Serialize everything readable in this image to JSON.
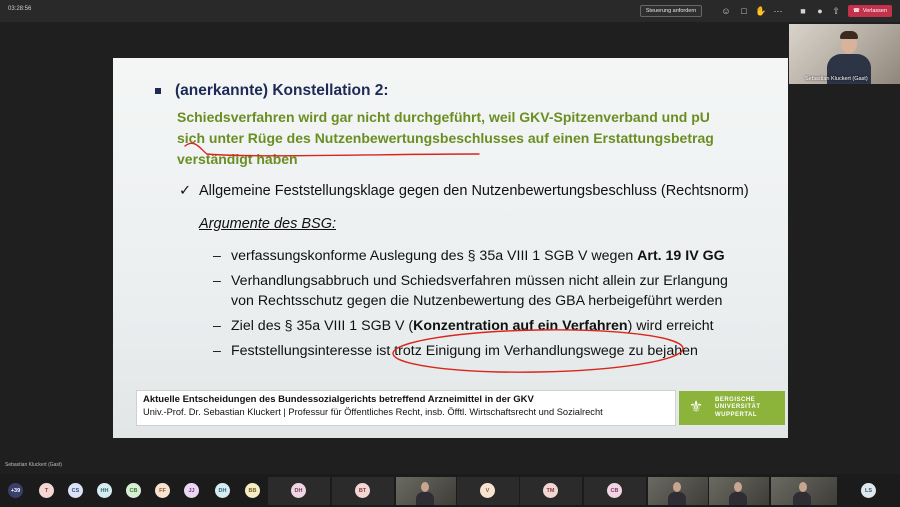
{
  "topbar": {
    "time": "03:28:56",
    "request_control_label": "Steuerung anfordern",
    "leave_label": "Verlassen",
    "icons": [
      "people-icon",
      "chat-icon",
      "reactions-icon",
      "more-icon",
      "camera-icon",
      "mic-icon",
      "share-icon"
    ]
  },
  "slide": {
    "heading": "(anerkannte) Konstellation 2:",
    "green_lines": [
      "Schiedsverfahren wird gar nicht durchgeführt, weil GKV-Spitzenverband und pU",
      "sich unter Rüge des Nutzenbewertungsbeschlusses auf einen Erstattungsbetrag",
      "verständigt haben"
    ],
    "check_item": "Allgemeine Feststellungsklage gegen den Nutzenbewertungsbeschluss (Rechtsnorm)",
    "arguments_heading": "Argumente des BSG:",
    "bullets": {
      "b1_pre": "verfassungskonforme Auslegung des § 35a VIII 1 SGB V wegen ",
      "b1_bold": "Art. 19 IV GG",
      "b2_line1": "Verhandlungsabbruch und Schiedsverfahren müssen nicht allein zur Erlangung",
      "b2_line2": "von Rechtsschutz gegen die Nutzenbewertung des GBA herbeigeführt werden",
      "b3_pre": "Ziel des § 35a VIII 1 SGB V (",
      "b3_bold": "Konzentration auf ein Verfahren",
      "b3_post": ") wird erreicht",
      "b4": "Feststellungsinteresse ist trotz Einigung im Verhandlungswege zu bejahen"
    },
    "footer_title": "Aktuelle Entscheidungen des Bundessozialgerichts betreffend Arzneimittel in der GKV",
    "footer_subtitle": "Univ.-Prof. Dr. Sebastian Kluckert | Professur für Öffentliches Recht, insb. Öfftl. Wirtschaftsrecht und Sozialrecht",
    "logo_line1": "BERGISCHE",
    "logo_line2": "UNIVERSITÄT",
    "logo_line3": "WUPPERTAL",
    "annotation_color": "#d8261c",
    "heading_color": "#1d2a56",
    "green_color": "#6b8e23"
  },
  "self_view": {
    "name": "Sebastian Kluckert (Gast)"
  },
  "presenter_label": "Sebastian Kluckert (Gast)",
  "participants": {
    "overflow": "+39",
    "avatars": [
      {
        "initials": "T",
        "color": "#f2d7d5",
        "text": "#8a3b36"
      },
      {
        "initials": "CS",
        "color": "#dce3f5",
        "text": "#3a4d86"
      },
      {
        "initials": "HH",
        "color": "#d6ecf1",
        "text": "#2f6a78"
      },
      {
        "initials": "CB",
        "color": "#d9efd6",
        "text": "#3b7a34"
      },
      {
        "initials": "FF",
        "color": "#f7e3cf",
        "text": "#8a5a2b"
      },
      {
        "initials": "JJ",
        "color": "#ead7f1",
        "text": "#6b3c7c"
      },
      {
        "initials": "DH",
        "color": "#d6ecf1",
        "text": "#2f6a78"
      },
      {
        "initials": "BB",
        "color": "#f5ecc8",
        "text": "#7a6420"
      }
    ],
    "tiles": [
      {
        "initials": "DH",
        "color": "#f0d6e4",
        "text": "#7c3b5d"
      },
      {
        "initials": "BT",
        "color": "#f2d7d5",
        "text": "#8a3b36"
      },
      {
        "initials": "V",
        "color": "#f7e3cf",
        "text": "#8a5a2b"
      },
      {
        "initials": "TM",
        "color": "#f2d7d5",
        "text": "#8a3b36"
      },
      {
        "initials": "CB",
        "color": "#f0d6e4",
        "text": "#7c3b5d"
      }
    ],
    "last": {
      "initials": "LS",
      "color": "#dfe8ee",
      "text": "#3b5766"
    }
  }
}
